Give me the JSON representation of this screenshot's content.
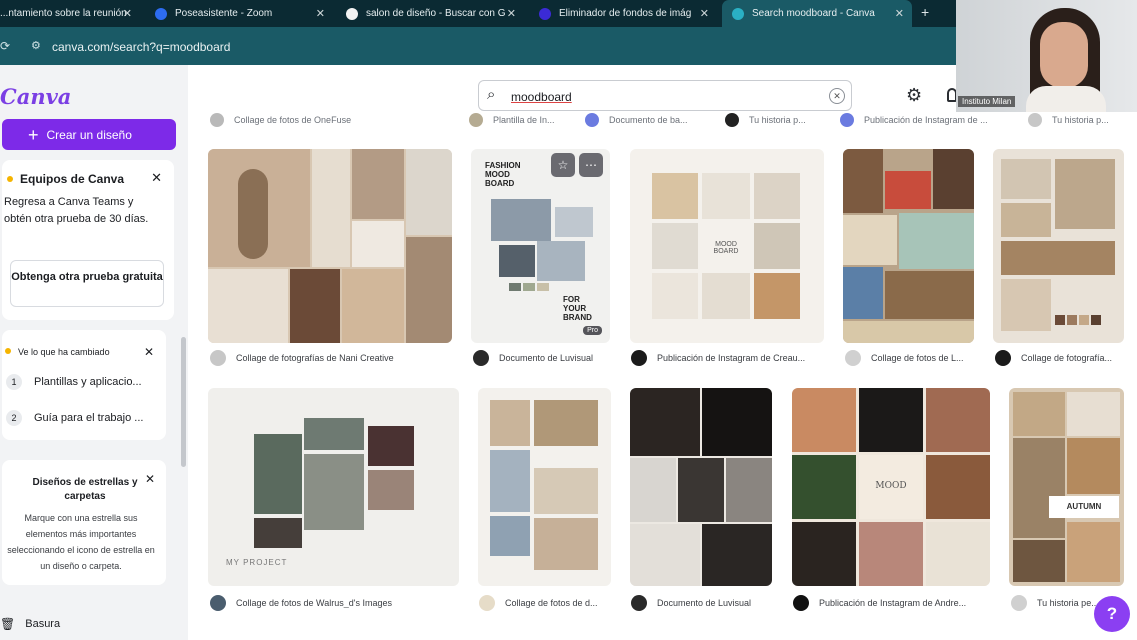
{
  "browser": {
    "tabs": [
      {
        "label": "...ntamiento sobre la reunión",
        "fav": "#e8a23a"
      },
      {
        "label": "Poseasistente - Zoom",
        "fav": "#2d6cf0"
      },
      {
        "label": "salon de diseño - Buscar con G",
        "fav": "#f0f0f0"
      },
      {
        "label": "Eliminador de fondos de imág",
        "fav": "#3b2bd6"
      },
      {
        "label": "Search moodboard - Canva",
        "fav": "#2ab0c4"
      }
    ],
    "new_tab": "+",
    "address": "canva.com/search?q=moodboard"
  },
  "sidebar": {
    "logo": "Canva",
    "create_button": "Crear un diseño",
    "teams_card": {
      "title": "Equipos de Canva",
      "body": "Regresa a Canva Teams y obtén otra prueba de 30 días.",
      "button": "Obtenga otra prueba gratuita"
    },
    "changes_card": {
      "title": "Ve lo que ha cambiado",
      "items": [
        {
          "num": "1",
          "label": "Plantillas y aplicacio..."
        },
        {
          "num": "2",
          "label": "Guía para el trabajo ..."
        }
      ]
    },
    "starred_card": {
      "title": "Diseños de estrellas y carpetas",
      "body": "Marque con una estrella sus elementos más importantes seleccionando el icono de estrella en un diseño o carpeta."
    },
    "trash": "Basura"
  },
  "search": {
    "value": "moodboard"
  },
  "top_row_captions": [
    "Collage de fotos de OneFuse",
    "Plantilla de In...",
    "Documento de ba...",
    "Tu historia p...",
    "Publicación de Instagram de ...",
    "Tu historia p..."
  ],
  "row1": [
    {
      "caption": "Collage de fotografías de Nani Creative"
    },
    {
      "caption": "Documento de Luvisual",
      "tile_text": "FASHION MOOD BOARD",
      "tile_text2": "FOR YOUR BRAND",
      "badge": "Pro"
    },
    {
      "caption": "Publicación de Instagram de Creau...",
      "tile_text": "MOOD BOARD"
    },
    {
      "caption": "Collage de fotos de L..."
    },
    {
      "caption": "Collage de fotografía..."
    }
  ],
  "row2": [
    {
      "caption": "Collage de fotos de Walrus_d's Images",
      "tile_text": "MY PROJECT"
    },
    {
      "caption": "Collage de fotos de d..."
    },
    {
      "caption": "Documento de Luvisual"
    },
    {
      "caption": "Publicación de Instagram de Andre...",
      "tile_text": "MOOD"
    },
    {
      "caption": "Tu historia pe...",
      "tile_text": "AUTUMN"
    }
  ],
  "webcam": {
    "name": "Instituto Milan"
  },
  "help": "?"
}
